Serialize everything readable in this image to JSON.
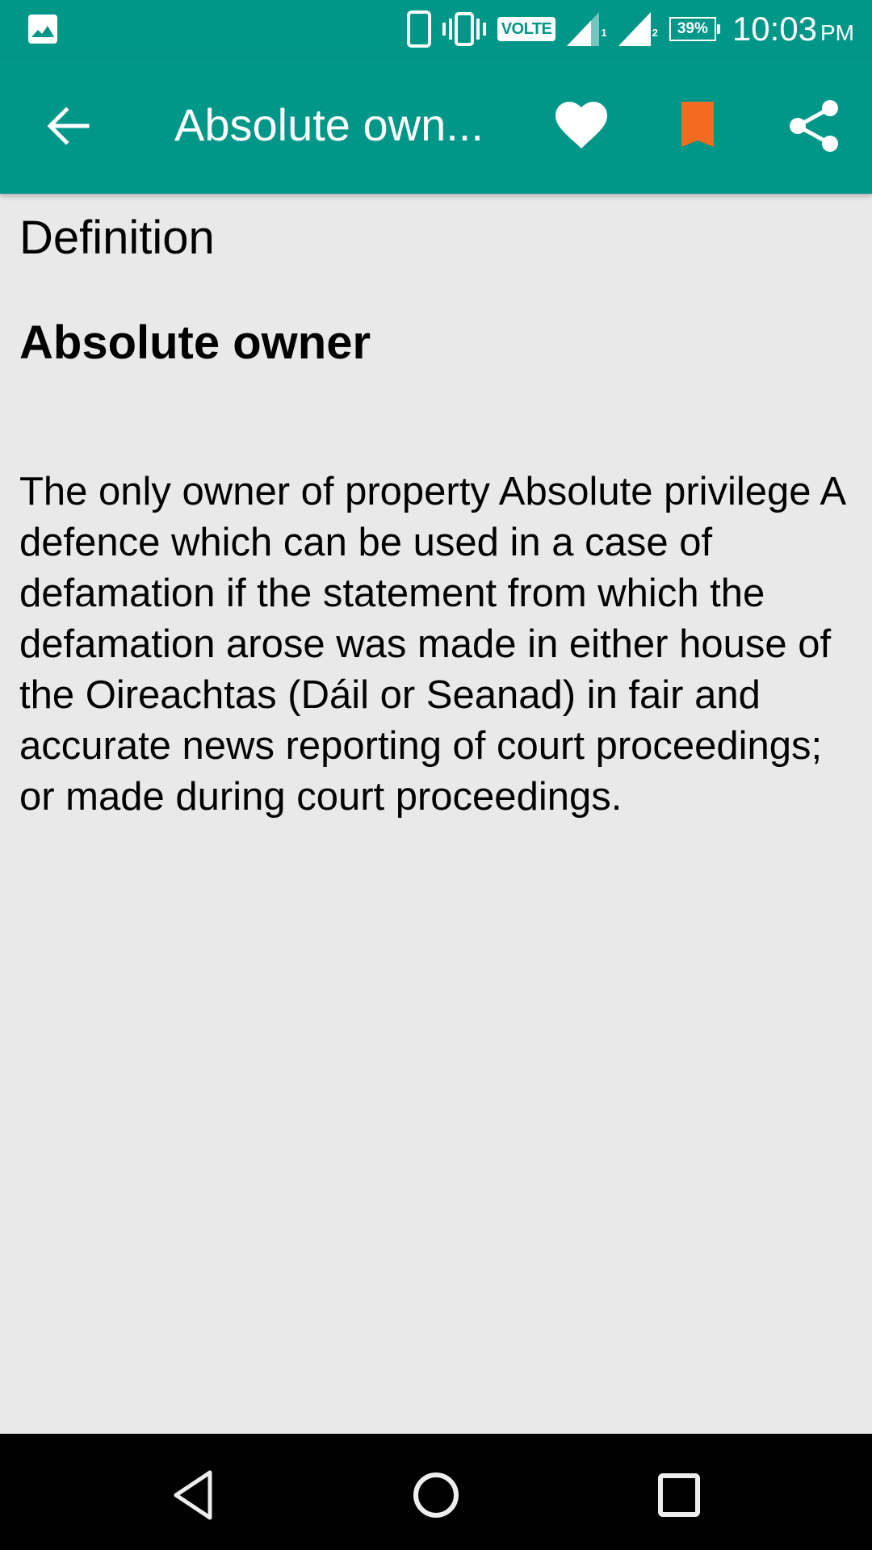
{
  "status_bar": {
    "notification_icons": [
      "gallery-icon"
    ],
    "indicators": [
      "phone-icon",
      "vibrate-icon"
    ],
    "volte_label": "VOLTE",
    "sim1_label": "1",
    "sim2_label": "2",
    "battery_text": "39%",
    "time": "10:03",
    "ampm": "PM"
  },
  "toolbar": {
    "title": "Absolute own...",
    "back_icon": "arrow-back-icon",
    "actions": [
      {
        "name": "favorite",
        "icon": "heart-icon",
        "color": "#ffffff"
      },
      {
        "name": "bookmark",
        "icon": "bookmark-icon",
        "color": "#f26b21"
      },
      {
        "name": "share",
        "icon": "share-icon",
        "color": "#ffffff"
      }
    ],
    "background_color": "#009688"
  },
  "content": {
    "section_label": "Definition",
    "term": "Absolute owner",
    "definition": "The only owner of property Absolute privilege A defence which can be used in a case of defamation if the statement from which the defamation arose was made in either house of the Oireachtas (Dáil or Seanad) in fair and accurate news reporting of court proceedings; or made during court proceedings."
  },
  "nav_bar": {
    "buttons": [
      "back-icon",
      "home-icon",
      "recents-icon"
    ]
  }
}
